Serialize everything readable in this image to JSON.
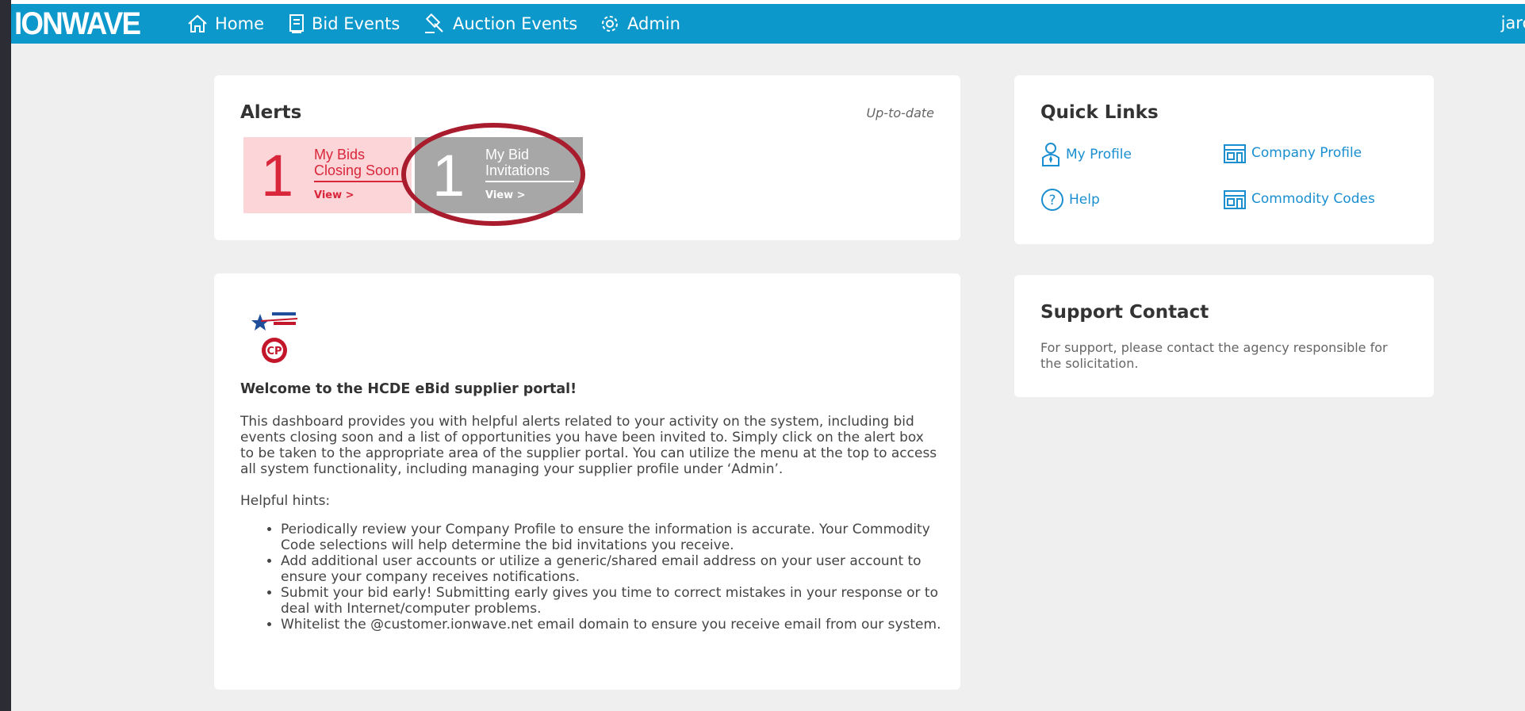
{
  "nav": {
    "logo": "IONWAVE",
    "items": [
      {
        "label": "Home",
        "icon": "home-icon"
      },
      {
        "label": "Bid Events",
        "icon": "document-icon"
      },
      {
        "label": "Auction Events",
        "icon": "gavel-icon"
      },
      {
        "label": "Admin",
        "icon": "gear-icon"
      }
    ],
    "user": "jarc"
  },
  "alerts": {
    "title": "Alerts",
    "status": "Up-to-date",
    "boxes": [
      {
        "count": "1",
        "label_line1": "My Bids",
        "label_line2": "Closing Soon",
        "link": "View >",
        "bg": "#fbd5d8",
        "color": "#d9263a"
      },
      {
        "count": "1",
        "label_line1": "My Bid",
        "label_line2": "Invitations",
        "link": "View >",
        "bg": "#a7a7a7",
        "color": "#ffffff"
      }
    ],
    "highlight_color": "#a81c2e"
  },
  "quick_links": {
    "title": "Quick Links",
    "items": [
      {
        "label": "My Profile",
        "icon": "user-icon"
      },
      {
        "label": "Company Profile",
        "icon": "building-icon"
      },
      {
        "label": "Help",
        "icon": "help-icon"
      },
      {
        "label": "Commodity Codes",
        "icon": "building-icon"
      }
    ],
    "link_color": "#1a8fd0"
  },
  "support": {
    "title": "Support Contact",
    "text": "For support, please contact the agency responsible for the solicitation."
  },
  "welcome": {
    "logo_icon": "agency-logo-icon",
    "heading": "Welcome to the HCDE eBid supplier portal!",
    "body": "This dashboard provides you with helpful alerts related to your activity on the system, including bid events closing soon and a list of opportunities you have been invited to. Simply click on the alert box to be taken to the appropriate area of the supplier portal. You can utilize the menu at the top to access all system functionality, including managing your supplier profile under ‘Admin’.",
    "hints_label": "Helpful hints:",
    "hints": [
      "Periodically review your Company Profile to ensure the information is accurate. Your Commodity Code selections will help determine the bid invitations you receive.",
      "Add additional user accounts or utilize a generic/shared email address on your user account to ensure your company receives notifications.",
      "Submit your bid early! Submitting early gives you time to correct mistakes in your response or to deal with Internet/computer problems.",
      "Whitelist the @customer.ionwave.net email domain to ensure you receive email from our system."
    ]
  },
  "colors": {
    "navbar": "#0d98cb",
    "page_bg": "#efefef"
  }
}
